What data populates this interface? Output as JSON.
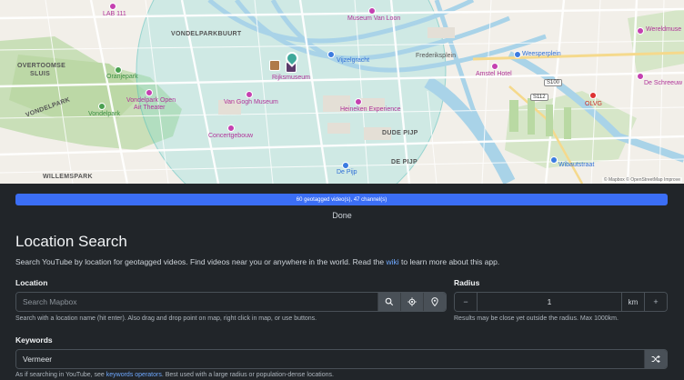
{
  "map": {
    "neighborhoods": [
      "VONDELPARKBUURT",
      "OVERTOOMSE",
      "SLUIS",
      "VONDELPARK",
      "WILLEMSPARK",
      "DUDE PIJP",
      "DE PIJP"
    ],
    "pois": {
      "lab111": "LAB 111",
      "orangpark": "Oranjepark",
      "vondelpark": "Vondelpark",
      "openair": "Vondelpark Open",
      "openair2": "Air Theater",
      "vangogh": "Van Gogh Museum",
      "concert": "Concertgebouw",
      "rijks": "Rijksmuseum",
      "vanloon": "Museum Van Loon",
      "vijzel": "Vijzelgracht",
      "frederik": "Frederiksplein",
      "weesper": "Weesperplein",
      "amstel": "Amstel Hotel",
      "heineken": "Heineken Experience",
      "depijp_station": "De Pijp",
      "wibaut": "Wibautstraat",
      "olvg": "OLVG",
      "wereld": "Wereldmuse",
      "schreeuw": "De Schreeuw"
    },
    "shields": [
      "S100",
      "S112"
    ],
    "attribution": "© Mapbox © OpenStreetMap Improve"
  },
  "progress": {
    "text": "60 geotagged video(s), 47 channel(s)",
    "percent": 100,
    "status": "Done"
  },
  "page": {
    "title": "Location Search",
    "desc_before": "Search YouTube by location for geotagged videos. Find videos near you or anywhere in the world. Read the ",
    "desc_link": "wiki",
    "desc_after": " to learn more about this app."
  },
  "location": {
    "label": "Location",
    "placeholder": "Search Mapbox",
    "value": "",
    "help": "Search with a location name (hit enter). Also drag and drop point on map, right click in map, or use buttons.",
    "icons": [
      "search-icon",
      "crosshair-icon",
      "map-pin-icon"
    ]
  },
  "radius": {
    "label": "Radius",
    "decrement": "−",
    "value": "1",
    "unit": "km",
    "increment": "+",
    "help": "Results may be close yet outside the radius. Max 1000km."
  },
  "keywords": {
    "label": "Keywords",
    "value": "Vermeer",
    "help_before": "As if searching in YouTube, see ",
    "help_link": "keywords operators",
    "help_after": ". Best used with a large radius or population-dense locations.",
    "icon": "shuffle-icon"
  }
}
